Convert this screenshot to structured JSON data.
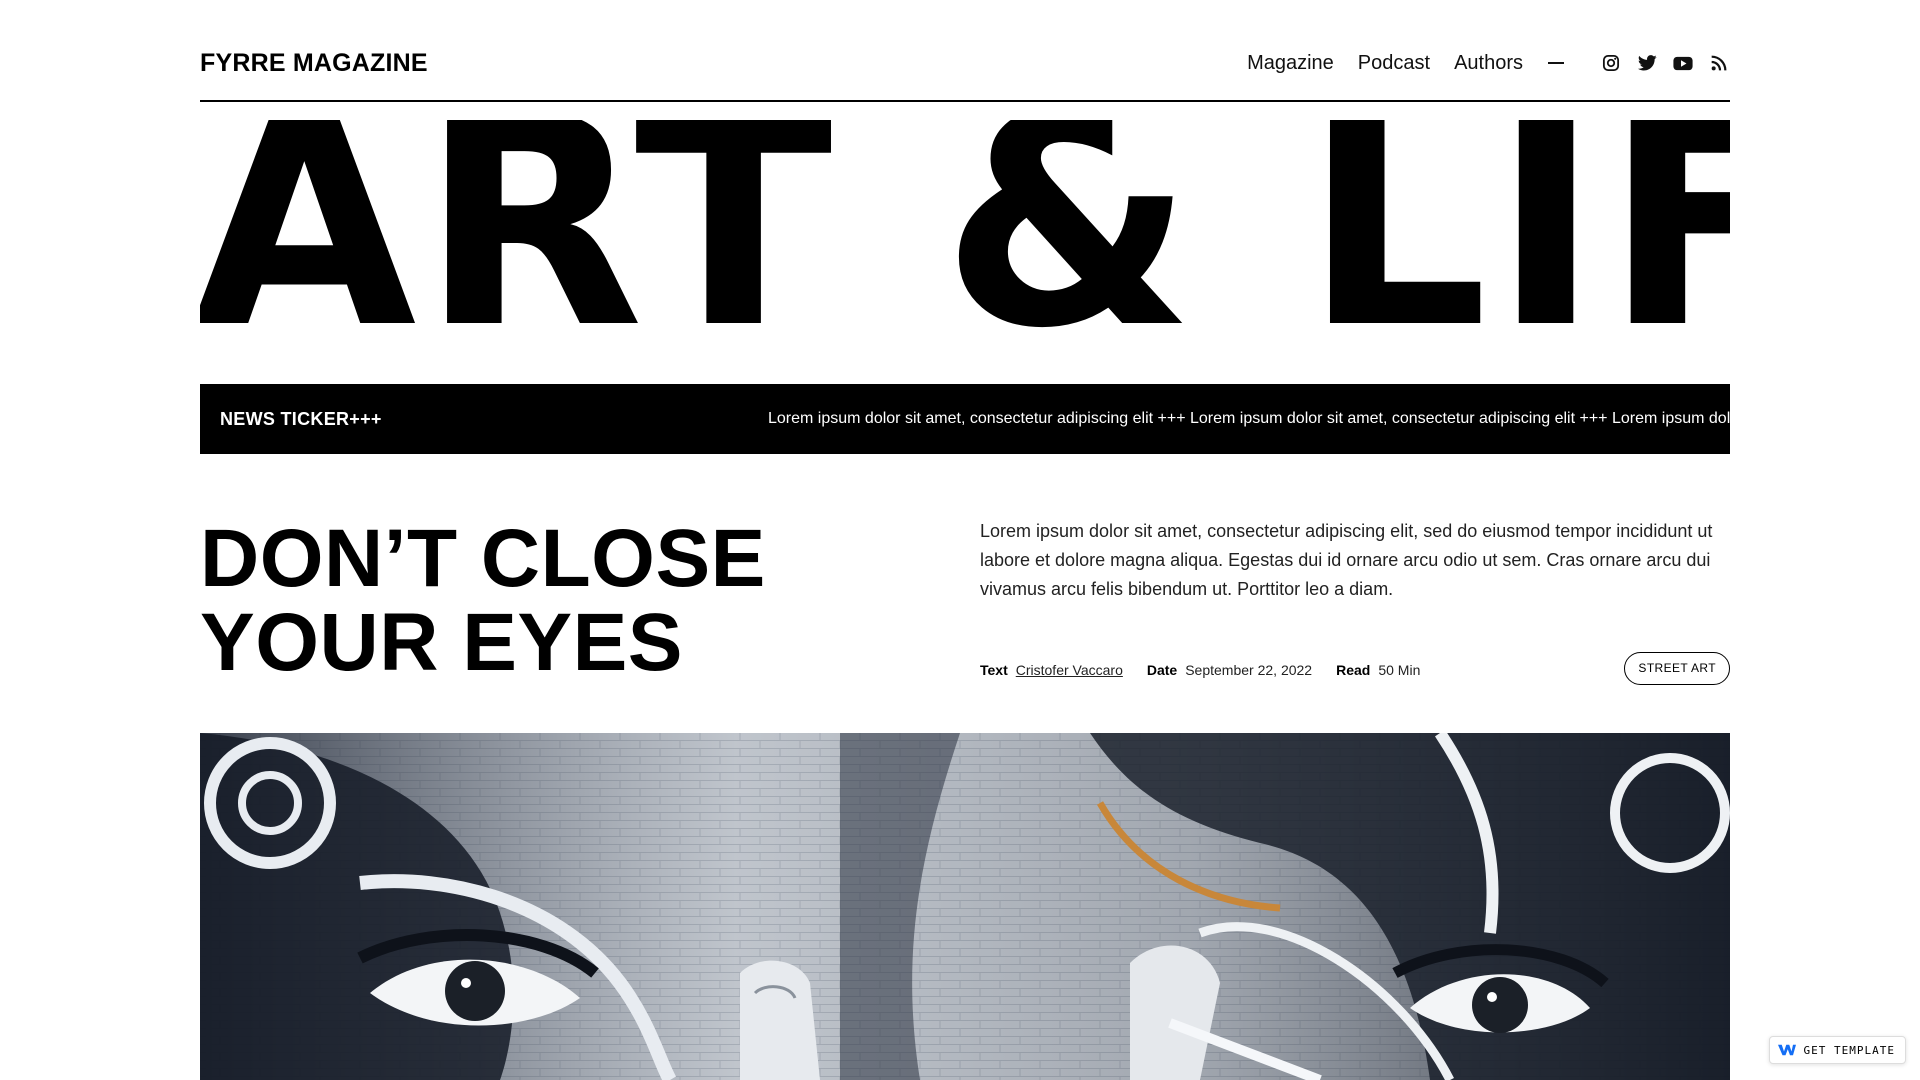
{
  "header": {
    "brand": "FYRRE MAGAZINE",
    "nav": [
      "Magazine",
      "Podcast",
      "Authors"
    ],
    "social_icons": [
      "instagram-icon",
      "twitter-icon",
      "youtube-icon",
      "rss-icon"
    ]
  },
  "hero": {
    "title": "ART & LIFE"
  },
  "ticker": {
    "label": "NEWS TICKER+++",
    "text": "Lorem ipsum dolor sit amet, consectetur adipiscing elit +++ Lorem ipsum dolor sit amet, consectetur adipiscing elit +++ Lorem ipsum dolor sit amet"
  },
  "article": {
    "headline_line1": "DON’T CLOSE",
    "headline_line2": "YOUR EYES",
    "intro": "Lorem ipsum dolor sit amet, consectetur adipiscing elit, sed do eiusmod tempor incididunt ut labore et dolore magna aliqua. Egestas dui id ornare arcu odio ut sem. Cras ornare arcu dui vivamus arcu felis bibendum ut. Porttitor leo a diam.",
    "meta": {
      "text_label": "Text",
      "author": "Cristofer Vaccaro",
      "date_label": "Date",
      "date": "September 22, 2022",
      "read_label": "Read",
      "read_time": "50 Min"
    },
    "tag": "STREET ART"
  },
  "badge": {
    "label": "GET TEMPLATE"
  },
  "colors": {
    "ink": "#000000",
    "paper": "#ffffff",
    "accent_badge": "#146ef5"
  }
}
